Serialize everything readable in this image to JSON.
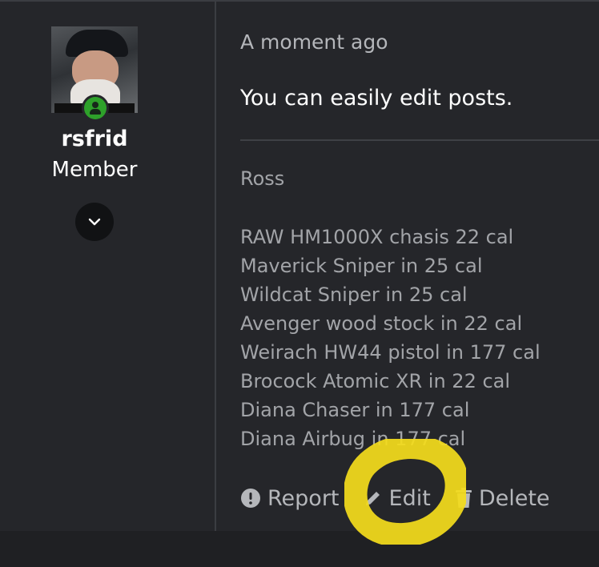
{
  "author": {
    "username": "rsfrid",
    "role": "Member",
    "avatar_icon": "user-avatar-photo",
    "status_icon": "online-status-icon",
    "expand_icon": "chevron-down-icon"
  },
  "post": {
    "timestamp": "A moment ago",
    "text": "You can easily edit posts."
  },
  "signature": {
    "name": "Ross",
    "lines": [
      "RAW HM1000X chasis 22 cal",
      "Maverick Sniper in 25 cal",
      "Wildcat Sniper in 25 cal",
      "Avenger wood stock in 22 cal",
      "Weirach HW44 pistol in 177 cal",
      "Brocock Atomic XR in 22 cal",
      "Diana Chaser in 177 cal",
      "Diana Airbug in 177 cal"
    ]
  },
  "actions": {
    "report": "Report",
    "edit": "Edit",
    "delete": "Delete"
  },
  "colors": {
    "background": "#25262a",
    "border": "#3b3d42",
    "online": "#2ea12a",
    "highlight": "#f3dc1c"
  }
}
